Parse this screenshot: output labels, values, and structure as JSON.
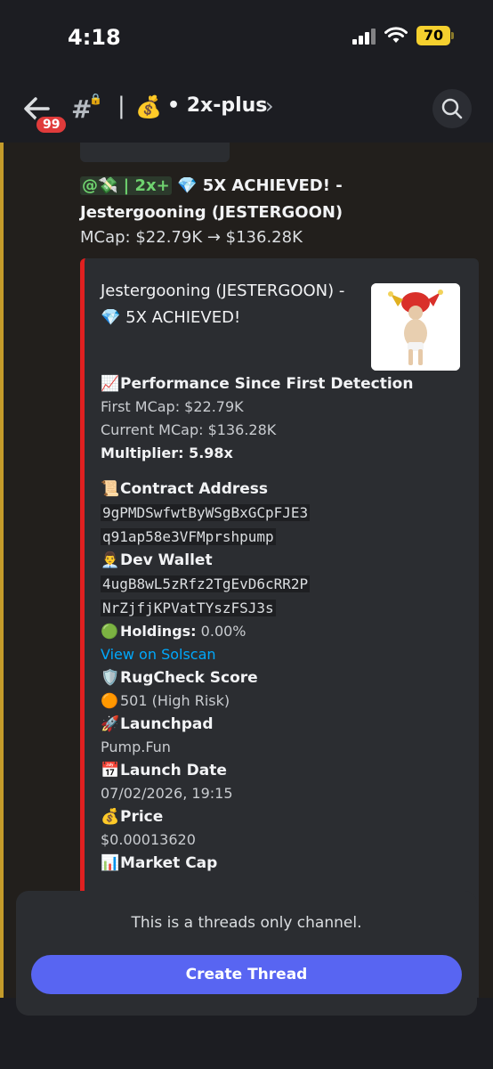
{
  "status_bar": {
    "time": "4:18",
    "battery": "70"
  },
  "header": {
    "unread_badge": "99",
    "thread_icon": "#",
    "separator": "|",
    "channel_emoji": "💰",
    "channel_name": "• 2x-plus",
    "chevron": "›"
  },
  "message": {
    "mention_prefix": "@💸 | 2x+",
    "title_rest": "💎 5X ACHIEVED! - Jestergooning (JESTERGOON)",
    "mcap_line": "MCap: $22.79K → $136.28K"
  },
  "embed": {
    "accent_color": "#e02020",
    "title": "Jestergooning (JESTERGOON) - 💎 5X ACHIEVED!",
    "performance": {
      "emoji": "📈",
      "heading": "Performance Since First Detection",
      "first_mcap": "First MCap: $22.79K",
      "current_mcap": "Current MCap: $136.28K",
      "multiplier": "Multiplier: 5.98x"
    },
    "contract": {
      "emoji": "📜",
      "heading": "Contract Address",
      "line1": "9gPMDSwfwtByWSgBxGCpFJE3",
      "line2": "q91ap58e3VFMprshpump"
    },
    "dev_wallet": {
      "emoji": "👨‍💼",
      "heading": "Dev Wallet",
      "line1": "4ugB8wL5zRfz2TgEvD6cRR2P",
      "line2": "NrZjfjKPVatTYszFSJ3s"
    },
    "holdings": {
      "emoji": "🟢",
      "label": "Holdings:",
      "value": "0.00%"
    },
    "solscan_link": "View on Solscan",
    "rugcheck": {
      "emoji": "🛡️",
      "heading": "RugCheck Score",
      "value_emoji": "🟠",
      "value": "501 (High Risk)"
    },
    "launchpad": {
      "emoji": "🚀",
      "heading": "Launchpad",
      "value": "Pump.Fun"
    },
    "launch_date": {
      "emoji": "📅",
      "heading": "Launch Date",
      "value": "07/02/2026, 19:15"
    },
    "price": {
      "emoji": "💰",
      "heading": "Price",
      "value": "$0.00013620"
    },
    "next_heading": {
      "emoji": "📊",
      "heading": "Market Cap"
    }
  },
  "threads_panel": {
    "notice": "This is a threads only channel.",
    "button_label": "Create Thread"
  }
}
